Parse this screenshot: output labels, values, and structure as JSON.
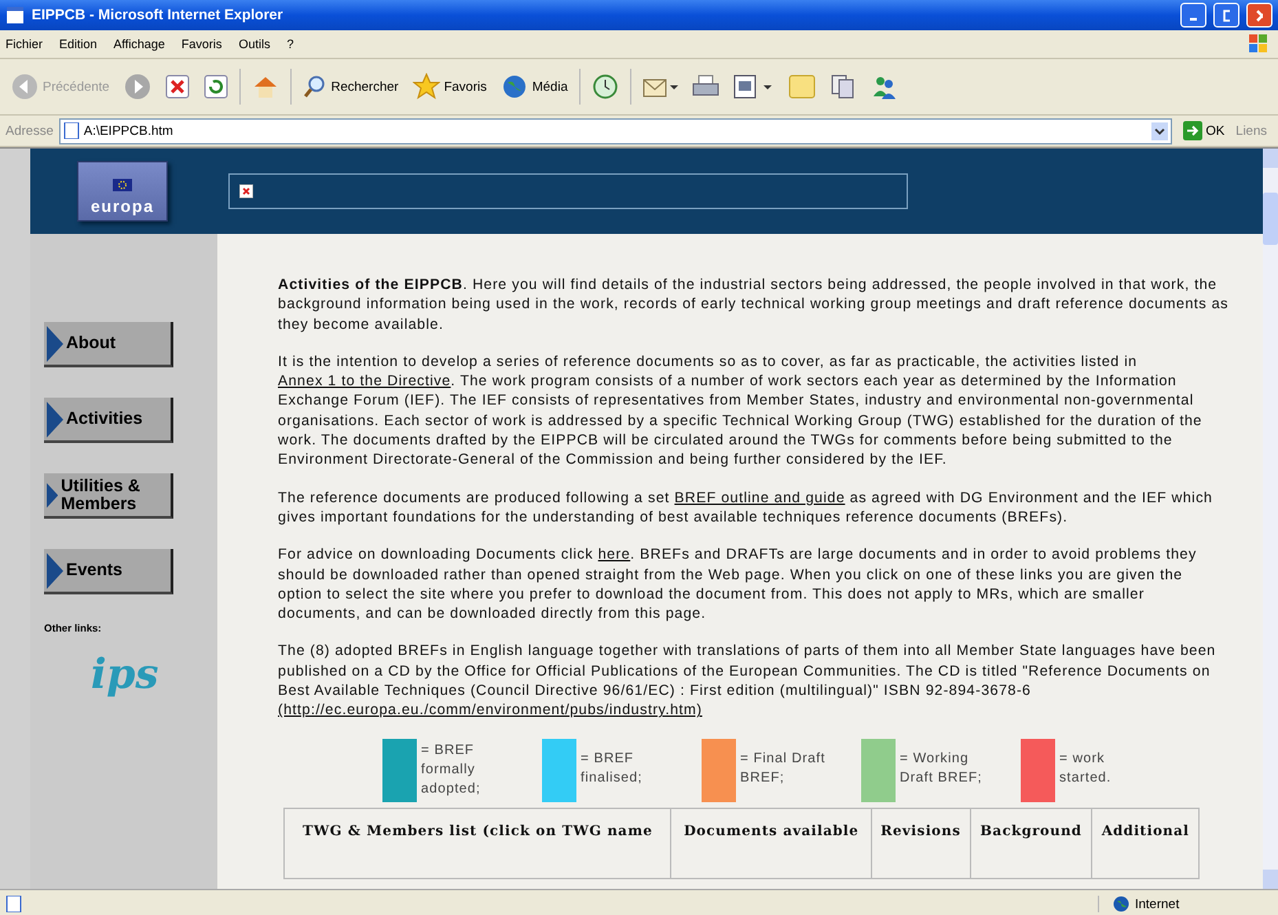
{
  "window": {
    "title": "EIPPCB - Microsoft Internet Explorer"
  },
  "menu": [
    "Fichier",
    "Edition",
    "Affichage",
    "Favoris",
    "Outils",
    "?"
  ],
  "toolbar": [
    {
      "kind": "back",
      "label": "Précédente",
      "disabled": true
    },
    {
      "kind": "forward"
    },
    {
      "kind": "stop"
    },
    {
      "kind": "refresh"
    },
    {
      "kind": "home"
    },
    {
      "kind": "search",
      "label": "Rechercher"
    },
    {
      "kind": "favorites",
      "label": "Favoris"
    },
    {
      "kind": "media",
      "label": "Média"
    },
    {
      "kind": "history"
    },
    {
      "kind": "mail"
    },
    {
      "kind": "print"
    },
    {
      "kind": "edit"
    },
    {
      "kind": "folder"
    },
    {
      "kind": "discuss"
    },
    {
      "kind": "messenger"
    }
  ],
  "address": {
    "label": "Adresse",
    "value": "A:\\EIPPCB.htm",
    "go": "OK",
    "links": "Liens"
  },
  "header": {
    "logo": "europa"
  },
  "sidebar": {
    "items": [
      "About",
      "Activities",
      "Utilities & Members",
      "Events"
    ],
    "other_links": "Other links:",
    "logo": "ips"
  },
  "paragraphs": [
    [
      {
        "text": "Activities of the EIPPCB",
        "bold": true
      },
      {
        "text": ". Here you will find details of the industrial sectors being addressed, the people involved in that work, the background information being used in the work, records of early technical working group meetings and draft reference documents as they become available."
      }
    ],
    [
      {
        "text": "It is the intention to develop a series of reference documents so as to cover, as far as practicable, the activities listed in "
      },
      {
        "text": "Annex 1 to the Directive",
        "link": true
      },
      {
        "text": ". The work program consists of a number of work sectors each year as determined by the Information Exchange Forum (IEF). The IEF consists of representatives from Member States, industry and environmental non-governmental organisations. Each sector of work is addressed by a specific Technical Working Group (TWG) established for the duration of the work. The documents drafted by the EIPPCB will be circulated around the TWGs for comments before being submitted to the Environment Directorate-General of the Commission and being further considered by the IEF."
      }
    ],
    [
      {
        "text": "The reference documents are produced following a set "
      },
      {
        "text": "BREF outline and guide",
        "link": true
      },
      {
        "text": " as agreed with DG Environment and the IEF which gives important foundations for the understanding of best available techniques reference documents (BREFs)."
      }
    ],
    [
      {
        "text": "For advice on downloading Documents click "
      },
      {
        "text": "here",
        "link": true
      },
      {
        "text": ". BREFs and DRAFTs are large documents and in order to avoid problems they should be downloaded rather than opened straight from the Web page. When you click on one of these links you are given the option to select the site where you prefer to download the document from. This does not apply to MRs, which are smaller documents, and can be downloaded directly from this page."
      }
    ],
    [
      {
        "text": "The (8) adopted BREFs in English language together with translations of parts of them into all Member State languages have been published on a CD by the Office for Official Publications of the European Communities. The CD is titled \"Reference Documents on Best Available Techniques (Council Directive 96/61/EC) : First edition (multilingual)\" ISBN 92-894-3678-6 "
      },
      {
        "text": "(http://ec.europa.eu./comm/environment/pubs/industry.htm)",
        "link": true
      }
    ]
  ],
  "legend": [
    {
      "label": "= BREF formally adopted;",
      "color": "#1aa3b0"
    },
    {
      "label": "= BREF finalised;",
      "color": "#33ccf5"
    },
    {
      "label": "= Final Draft BREF;",
      "color": "#f79050"
    },
    {
      "label": "= Working Draft BREF;",
      "color": "#90cc8c"
    },
    {
      "label": "= work started.",
      "color": "#f55a5a"
    }
  ],
  "table": {
    "columns": [
      "TWG & Members list (click on TWG name",
      "Documents available",
      "Revisions",
      "Background",
      "Additional"
    ]
  },
  "status_bar": {
    "zone": "Internet"
  }
}
